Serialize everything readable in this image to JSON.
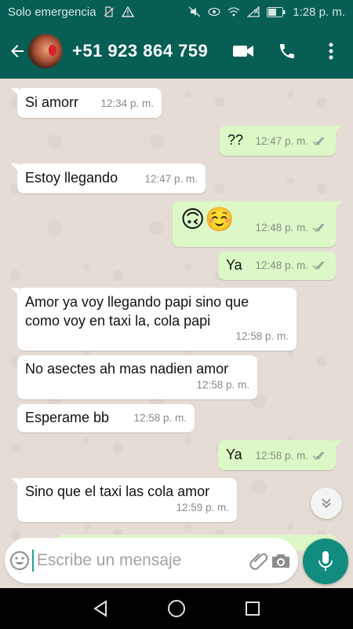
{
  "status_bar": {
    "carrier": "Solo emergencia",
    "battery_icon": "battery-icon",
    "time": "1:28 p. m."
  },
  "header": {
    "contact_phone": "+51 923 864 759",
    "icons": [
      "back-arrow-icon",
      "video-call-icon",
      "phone-call-icon",
      "more-vert-icon"
    ]
  },
  "colors": {
    "header": "#075e54",
    "chat_bg": "#e5ddd5",
    "incoming": "#ffffff",
    "outgoing": "#dcf8c6",
    "accent": "#128c7e"
  },
  "messages": [
    {
      "dir": "in",
      "text": "Si amorr",
      "time": "12:34 p. m."
    },
    {
      "dir": "out",
      "text": "??",
      "time": "12:47 p. m.",
      "status": "read"
    },
    {
      "dir": "in",
      "text": "Estoy llegando",
      "time": "12:47 p. m."
    },
    {
      "dir": "out",
      "text": "🙃☺️",
      "time": "12:48 p. m.",
      "status": "read"
    },
    {
      "dir": "out",
      "text": "Ya",
      "time": "12:48 p. m.",
      "status": "read"
    },
    {
      "dir": "in",
      "text": "Amor ya voy llegando papi sino que como voy en taxi la, cola papi",
      "time": "12:58 p. m."
    },
    {
      "dir": "in",
      "text": "No asectes ah mas nadien amor",
      "time": "12:58 p. m."
    },
    {
      "dir": "in",
      "text": "Esperame bb",
      "time": "12:58 p. m."
    },
    {
      "dir": "out",
      "text": "Ya",
      "time": "12:58 p. m.",
      "status": "read"
    },
    {
      "dir": "in",
      "text": "Sino que el taxi las cola amor",
      "time": "12:59 p. m."
    }
  ],
  "composer": {
    "placeholder": "Escribe un mensaje",
    "icons": [
      "emoji-icon",
      "attach-icon",
      "camera-icon",
      "mic-icon"
    ]
  },
  "nav_bar": {
    "icons": [
      "back-triangle-icon",
      "home-circle-icon",
      "recents-square-icon"
    ]
  }
}
